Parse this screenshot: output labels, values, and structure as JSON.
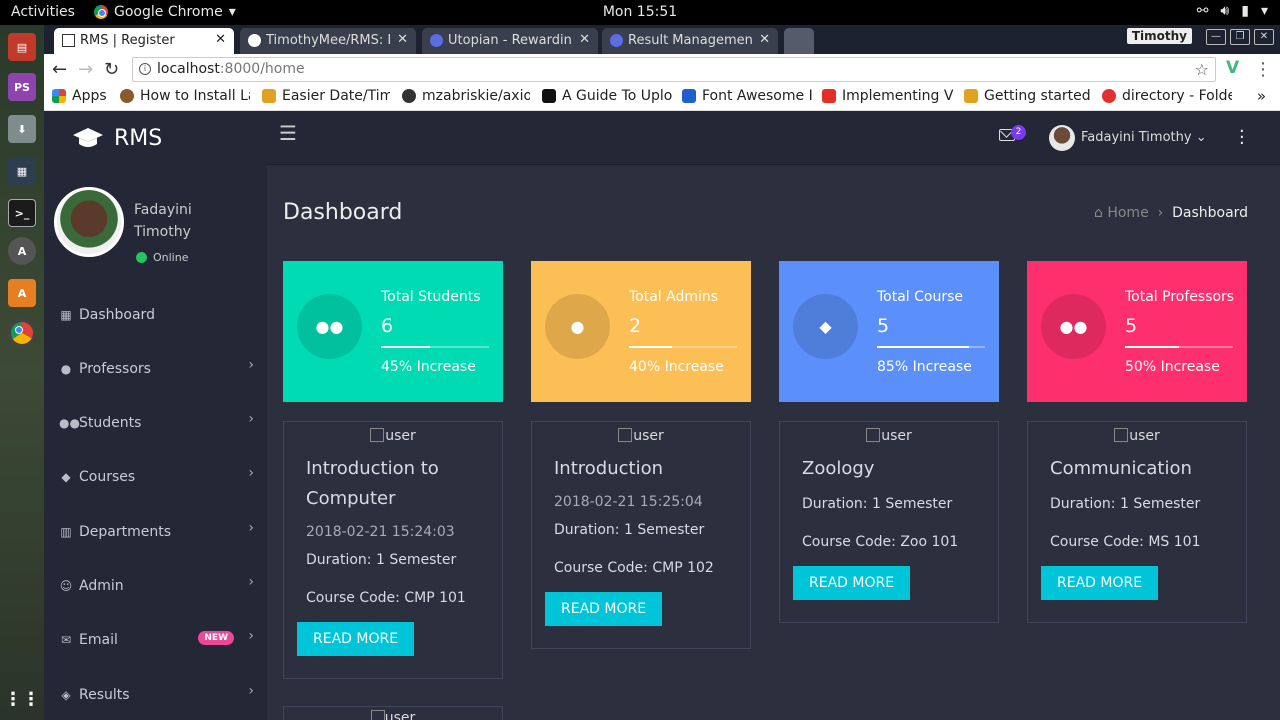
{
  "os": {
    "activities": "Activities",
    "app_name": "Google Chrome",
    "clock": "Mon 15:51"
  },
  "browser": {
    "tabs": [
      {
        "label": "RMS | Register",
        "active": true
      },
      {
        "label": "TimothyMee/RMS: I",
        "active": false
      },
      {
        "label": "Utopian - Rewardin",
        "active": false
      },
      {
        "label": "Result Managemen",
        "active": false
      }
    ],
    "profile": "Timothy",
    "url_host": "localhost",
    "url_rest": ":8000/home",
    "bookmarks": [
      {
        "label": "Apps",
        "color": "#4285f4"
      },
      {
        "label": "How to Install La",
        "color": "#8b5a2b"
      },
      {
        "label": "Easier Date/Time",
        "color": "#e0a020"
      },
      {
        "label": "mzabriskie/axios",
        "color": "#333333"
      },
      {
        "label": "A Guide To Uploa",
        "color": "#111111"
      },
      {
        "label": "Font Awesome Ic",
        "color": "#1e60d0"
      },
      {
        "label": "Implementing V",
        "color": "#e52d27"
      },
      {
        "label": "Getting started v",
        "color": "#e0a020"
      },
      {
        "label": "directory - Folde",
        "color": "#e0312e"
      }
    ]
  },
  "app": {
    "brand": "RMS",
    "header": {
      "mail_count": "2",
      "user_name": "Fadayini Timothy"
    },
    "sidebar": {
      "profile_name": "Fadayini Timothy",
      "status": "Online",
      "items": [
        {
          "label": "Dashboard",
          "icon": "dashboard-icon",
          "chevron": false
        },
        {
          "label": "Professors",
          "icon": "user-icon",
          "chevron": true
        },
        {
          "label": "Students",
          "icon": "users-icon",
          "chevron": true
        },
        {
          "label": "Courses",
          "icon": "graduation-cap-icon",
          "chevron": true
        },
        {
          "label": "Departments",
          "icon": "building-icon",
          "chevron": true
        },
        {
          "label": "Admin",
          "icon": "smile-icon",
          "chevron": true
        },
        {
          "label": "Email",
          "icon": "envelope-icon",
          "chevron": true,
          "badge": "NEW"
        },
        {
          "label": "Results",
          "icon": "cube-icon",
          "chevron": true
        }
      ]
    },
    "page_title": "Dashboard",
    "breadcrumb": {
      "home": "Home",
      "current": "Dashboard"
    },
    "stats": [
      {
        "label": "Total Students",
        "value": "6",
        "progress": 0.45,
        "note": "45% Increase",
        "color": "#00dbb4",
        "icon": "users-icon"
      },
      {
        "label": "Total Admins",
        "value": "2",
        "progress": 0.4,
        "note": "40% Increase",
        "color": "#fcbf55",
        "icon": "user-icon"
      },
      {
        "label": "Total Course",
        "value": "5",
        "progress": 0.85,
        "note": "85% Increase",
        "color": "#5b8ff9",
        "icon": "graduation-cap-icon"
      },
      {
        "label": "Total Professors",
        "value": "5",
        "progress": 0.5,
        "note": "50% Increase",
        "color": "#fd2f6c",
        "icon": "users-icon"
      }
    ],
    "courses": [
      {
        "img_alt": "user",
        "title": "Introduction to Computer",
        "date": "2018-02-21 15:24:03",
        "duration": "Duration: 1 Semester",
        "code": "Course Code: CMP 101",
        "button": "READ MORE"
      },
      {
        "img_alt": "user",
        "title": "Introduction",
        "date": "2018-02-21 15:25:04",
        "duration": "Duration: 1 Semester",
        "code": "Course Code: CMP 102",
        "button": "READ MORE"
      },
      {
        "img_alt": "user",
        "title": "Zoology",
        "date": "",
        "duration": "Duration: 1 Semester",
        "code": "Course Code: Zoo 101",
        "button": "READ MORE"
      },
      {
        "img_alt": "user",
        "title": "Communication",
        "date": "",
        "duration": "Duration: 1 Semester",
        "code": "Course Code: MS 101",
        "button": "READ MORE"
      }
    ],
    "partial_card_img_alt": "user"
  }
}
